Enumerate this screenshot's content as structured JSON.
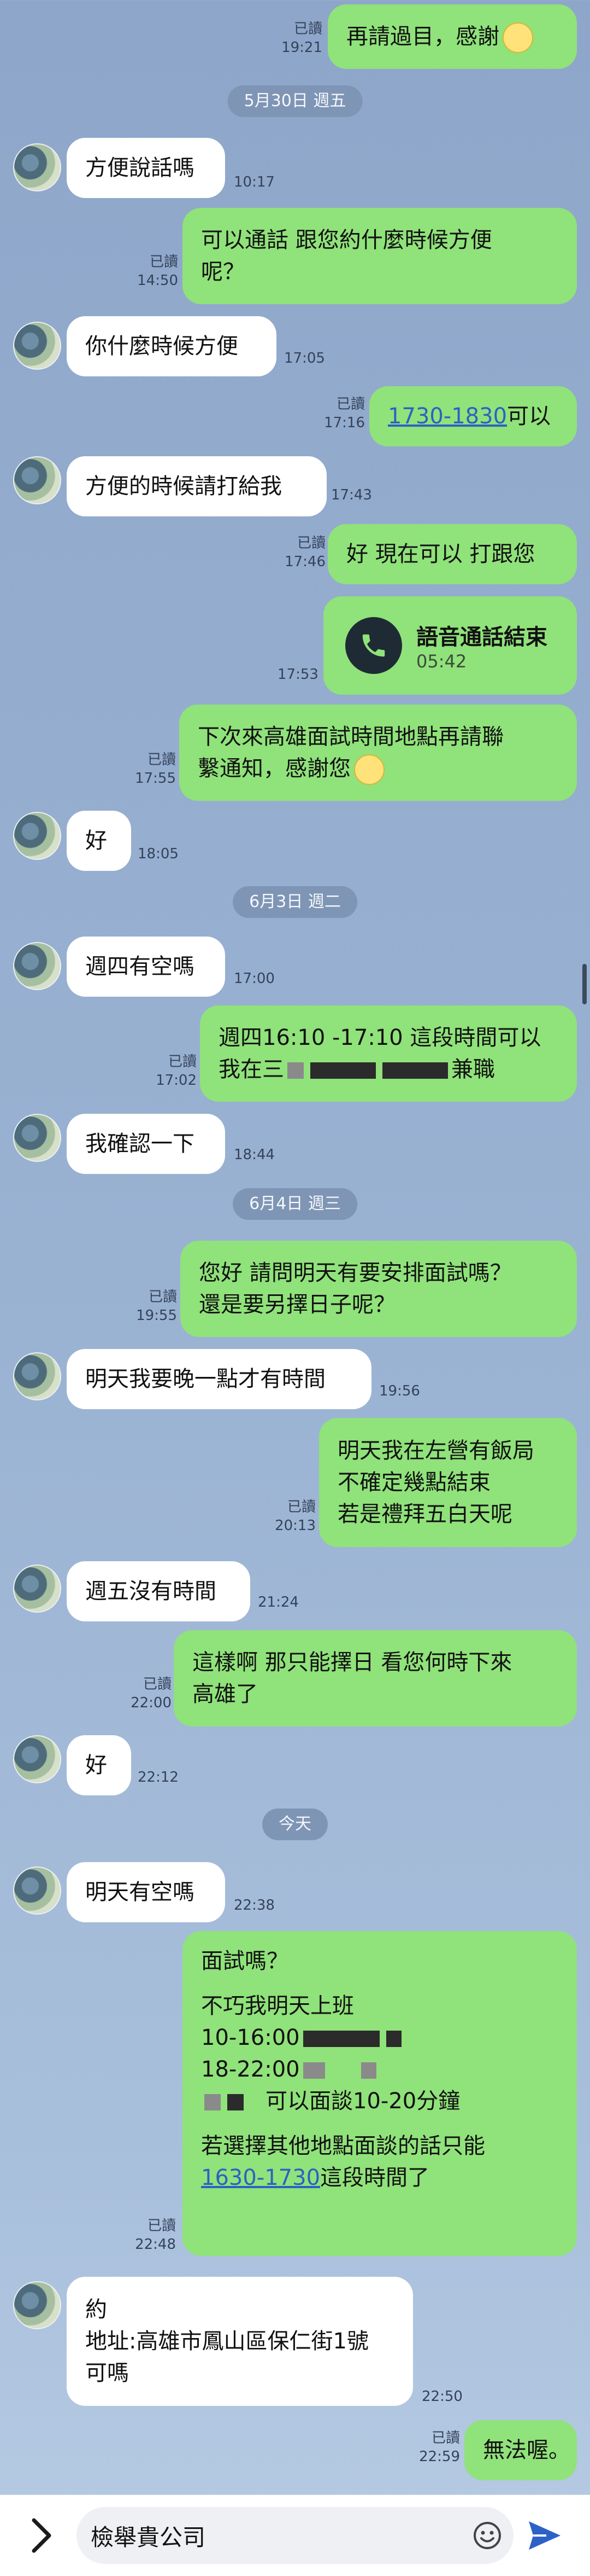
{
  "messages": [
    {
      "side": "out",
      "text": "再請過目，感謝",
      "read": "已讀",
      "time": "19:21"
    },
    {
      "type": "date",
      "text": "5月30日 週五"
    },
    {
      "side": "in",
      "text": "方便說話嗎",
      "time": "10:17"
    },
    {
      "side": "out",
      "lines": [
        "可以通話  跟您約什麼時候方便",
        "呢？"
      ],
      "read": "已讀",
      "time": "14:50"
    },
    {
      "side": "in",
      "text": "你什麼時候方便",
      "time": "17:05"
    },
    {
      "side": "out",
      "link": "1730-1830",
      "suffix": "可以",
      "read": "已讀",
      "time": "17:16"
    },
    {
      "side": "in",
      "text": "方便的時候請打給我",
      "time": "17:43"
    },
    {
      "side": "out",
      "text": "好 現在可以 打跟您",
      "read": "已讀",
      "time": "17:46"
    },
    {
      "type": "call",
      "title": "語音通話結束",
      "duration": "05:42",
      "time": "17:53"
    },
    {
      "side": "out",
      "lines": [
        "下次來高雄面試時間地點再請聯",
        "繫通知，感謝您"
      ],
      "read": "已讀",
      "time": "17:55"
    },
    {
      "side": "in",
      "text": "好",
      "time": "18:05"
    },
    {
      "type": "date",
      "text": "6月3日 週二"
    },
    {
      "side": "in",
      "text": "週四有空嗎",
      "time": "17:00"
    },
    {
      "side": "out",
      "lines": [
        "週四16:10 -17:10 這段時間可以",
        "我在三",
        "兼職"
      ],
      "read": "已讀",
      "time": "17:02"
    },
    {
      "side": "in",
      "text": "我確認一下",
      "time": "18:44"
    },
    {
      "type": "date",
      "text": "6月4日 週三"
    },
    {
      "side": "out",
      "lines": [
        "您好 請問明天有要安排面試嗎？",
        "還是要另擇日子呢？"
      ],
      "read": "已讀",
      "time": "19:55"
    },
    {
      "side": "in",
      "text": "明天我要晚一點才有時間",
      "time": "19:56"
    },
    {
      "side": "out",
      "lines": [
        "明天我在左營有飯局",
        "不確定幾點結束",
        "若是禮拜五白天呢"
      ],
      "read": "已讀",
      "time": "20:13"
    },
    {
      "side": "in",
      "text": "週五沒有時間",
      "time": "21:24"
    },
    {
      "side": "out",
      "lines": [
        "這樣啊  那只能擇日 看您何時下來",
        "高雄了"
      ],
      "read": "已讀",
      "time": "22:00"
    },
    {
      "side": "in",
      "text": "好",
      "time": "22:12"
    },
    {
      "type": "date",
      "text": "今天"
    },
    {
      "side": "in",
      "text": "明天有空嗎",
      "time": "22:38"
    },
    {
      "side": "out",
      "lines": [
        "面試嗎？",
        "不巧我明天上班",
        "10-16:00",
        "18-22:00",
        "可以面談10-20分鐘",
        "若選擇其他地點面談的話只能",
        "1630-1730",
        "這段時間了"
      ],
      "read": "已讀",
      "time": "22:48"
    },
    {
      "side": "in",
      "lines": [
        "約",
        "地址:高雄市鳳山區保仁街1號",
        "可嗎"
      ],
      "time": "22:50"
    },
    {
      "side": "out",
      "text": "無法喔。",
      "read": "已讀",
      "time": "22:59"
    }
  ],
  "input": {
    "value": "檢舉貴公司"
  },
  "icons": {
    "chevron": "chevron-right-icon",
    "emoji": "smile-icon",
    "send": "send-icon",
    "phone": "phone-icon"
  }
}
